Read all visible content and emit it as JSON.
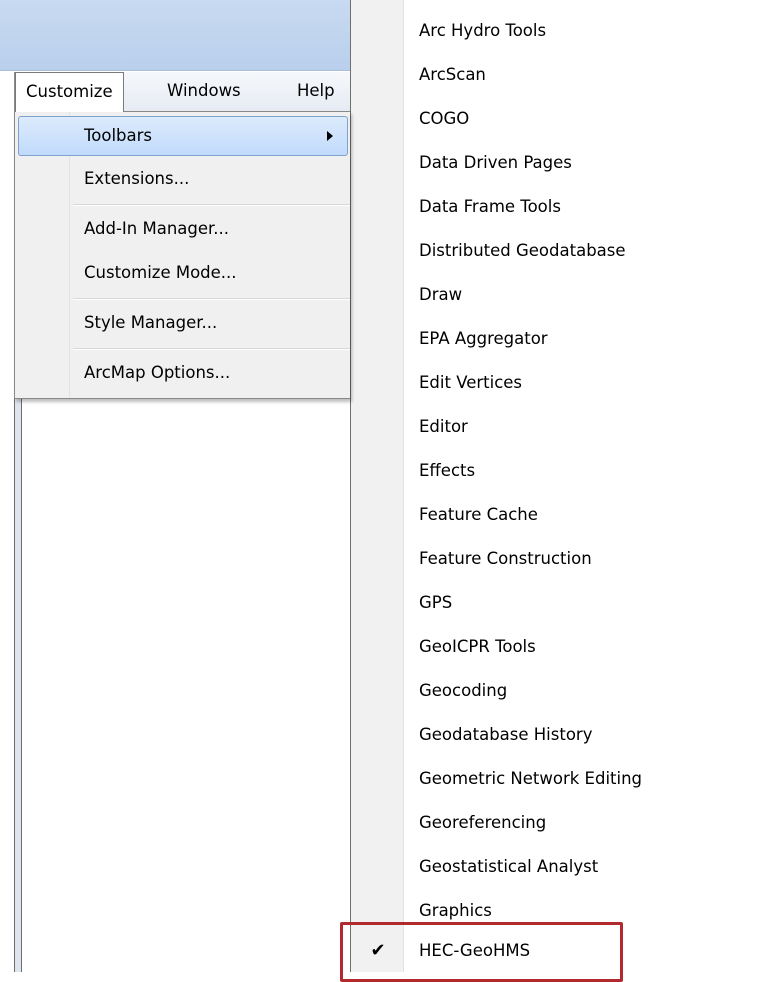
{
  "menubar": {
    "items": [
      {
        "label": "Customize"
      },
      {
        "label": "Windows"
      },
      {
        "label": "Help"
      }
    ]
  },
  "customize_menu": {
    "items": [
      {
        "label": "Toolbars"
      },
      {
        "label": "Extensions..."
      },
      {
        "label": "Add-In Manager..."
      },
      {
        "label": "Customize Mode..."
      },
      {
        "label": "Style Manager..."
      },
      {
        "label": "ArcMap Options..."
      }
    ]
  },
  "toolbars_submenu": {
    "items": [
      {
        "label": "Arc Hydro Tools"
      },
      {
        "label": "ArcScan"
      },
      {
        "label": "COGO"
      },
      {
        "label": "Data Driven Pages"
      },
      {
        "label": "Data Frame Tools"
      },
      {
        "label": "Distributed Geodatabase"
      },
      {
        "label": "Draw"
      },
      {
        "label": "EPA Aggregator"
      },
      {
        "label": "Edit Vertices"
      },
      {
        "label": "Editor"
      },
      {
        "label": "Effects"
      },
      {
        "label": "Feature Cache"
      },
      {
        "label": "Feature Construction"
      },
      {
        "label": "GPS"
      },
      {
        "label": "GeoICPR Tools"
      },
      {
        "label": "Geocoding"
      },
      {
        "label": "Geodatabase History"
      },
      {
        "label": "Geometric Network Editing"
      },
      {
        "label": "Georeferencing"
      },
      {
        "label": "Geostatistical Analyst"
      },
      {
        "label": "Graphics"
      },
      {
        "label": "HEC-GeoHMS",
        "checked": true
      }
    ],
    "check_glyph": "✔"
  },
  "colors": {
    "highlight_outline": "#b2292e",
    "menu_highlight": "#c1dbfc"
  }
}
